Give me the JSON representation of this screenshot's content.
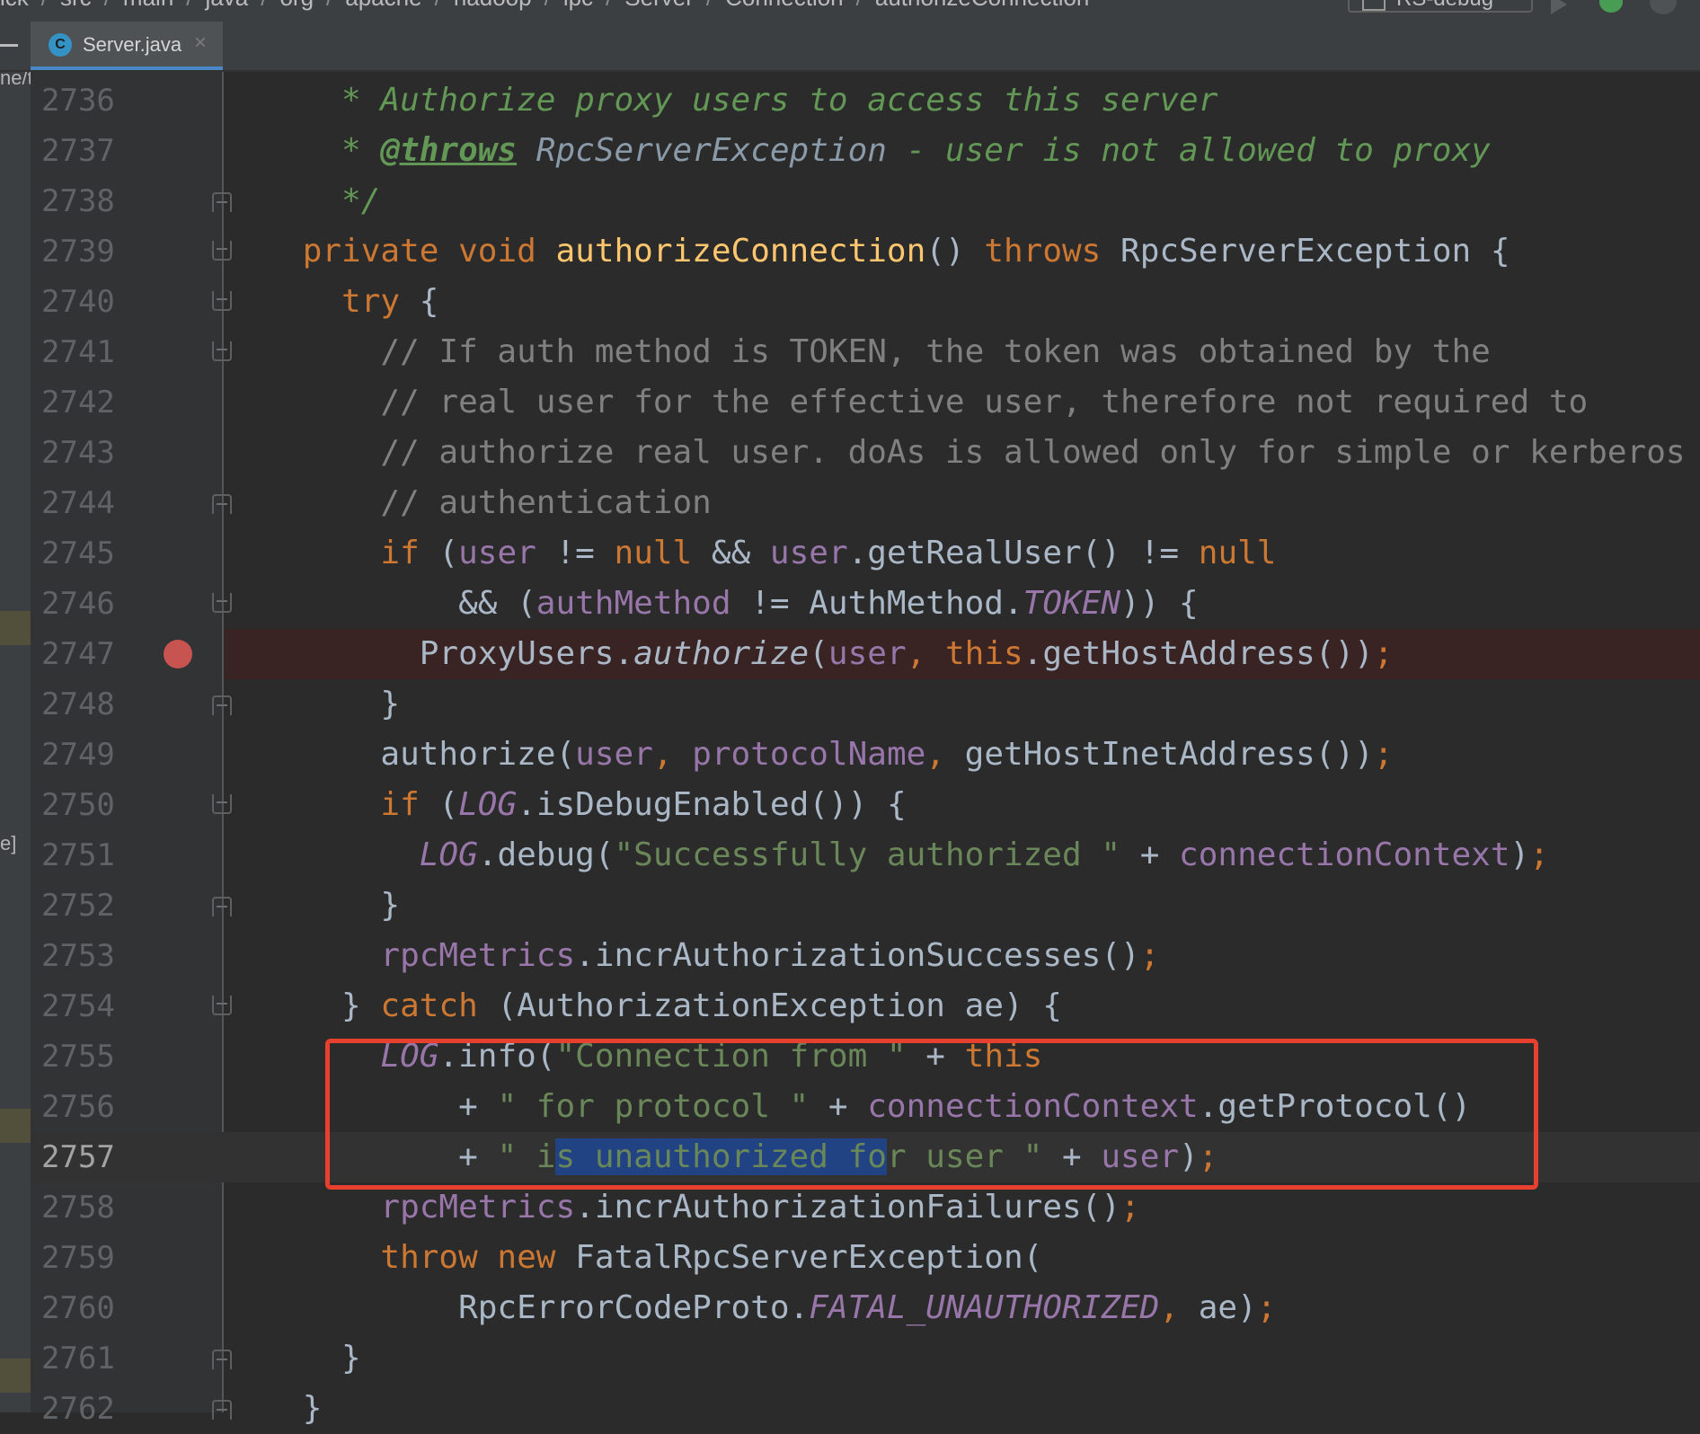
{
  "breadcrumb": [
    "ick",
    "src",
    "main",
    "java",
    "org",
    "apache",
    "hadoop",
    "ipc",
    "Server",
    "Connection",
    "authorizeConnection"
  ],
  "run_config": "RS-debug",
  "tab": {
    "label": "Server.java",
    "icon_letter": "C",
    "close": "×"
  },
  "left_strip": {
    "top_text": "ne/t",
    "mid_text": "e]"
  },
  "lines": [
    {
      "n": "2736",
      "fold": "",
      "segs": [
        [
          "doc",
          "      * Authorize proxy users to access this server"
        ]
      ]
    },
    {
      "n": "2737",
      "fold": "",
      "segs": [
        [
          "doc",
          "      * "
        ],
        [
          "tag",
          "@throws"
        ],
        [
          "doc",
          " "
        ],
        [
          "docref",
          "RpcServerException"
        ],
        [
          "doc",
          " - user is not allowed to proxy"
        ]
      ]
    },
    {
      "n": "2738",
      "fold": "open",
      "segs": [
        [
          "doc",
          "      */"
        ]
      ]
    },
    {
      "n": "2739",
      "fold": "close",
      "segs": [
        [
          "kw",
          "    private void "
        ],
        [
          "fn",
          "authorizeConnection"
        ],
        [
          "",
          "() "
        ],
        [
          "kw",
          "throws "
        ],
        [
          "",
          "RpcServerException {"
        ]
      ]
    },
    {
      "n": "2740",
      "fold": "close",
      "segs": [
        [
          "kw",
          "      try "
        ],
        [
          "",
          "{"
        ]
      ]
    },
    {
      "n": "2741",
      "fold": "close",
      "segs": [
        [
          "cm",
          "        // If auth method is TOKEN, the token was obtained by the"
        ]
      ]
    },
    {
      "n": "2742",
      "fold": "",
      "segs": [
        [
          "cm",
          "        // real user for the effective user, therefore not required to"
        ]
      ]
    },
    {
      "n": "2743",
      "fold": "",
      "segs": [
        [
          "cm",
          "        // authorize real user. doAs is allowed only for simple or kerberos"
        ]
      ]
    },
    {
      "n": "2744",
      "fold": "open",
      "segs": [
        [
          "cm",
          "        // authentication"
        ]
      ]
    },
    {
      "n": "2745",
      "fold": "",
      "segs": [
        [
          "kw",
          "        if "
        ],
        [
          "",
          "("
        ],
        [
          "fld",
          "user"
        ],
        [
          "",
          " != "
        ],
        [
          "kw",
          "null"
        ],
        [
          "",
          " && "
        ],
        [
          "fld",
          "user"
        ],
        [
          "",
          ".getRealUser() != "
        ],
        [
          "kw",
          "null"
        ]
      ]
    },
    {
      "n": "2746",
      "fold": "close",
      "segs": [
        [
          "",
          "            && ("
        ],
        [
          "fld",
          "authMethod"
        ],
        [
          "",
          " != AuthMethod."
        ],
        [
          "st",
          "TOKEN"
        ],
        [
          "",
          ")) {"
        ]
      ]
    },
    {
      "n": "2747",
      "fold": "",
      "bp": true,
      "segs": [
        [
          "",
          "          ProxyUsers."
        ],
        [
          "it",
          "authorize"
        ],
        [
          "",
          "("
        ],
        [
          "fld",
          "user"
        ],
        [
          "kw",
          ", this"
        ],
        [
          "",
          ".getHostAddress())"
        ],
        [
          "kw",
          ";"
        ]
      ]
    },
    {
      "n": "2748",
      "fold": "open",
      "segs": [
        [
          "",
          "        }"
        ]
      ]
    },
    {
      "n": "2749",
      "fold": "",
      "segs": [
        [
          "",
          "        authorize("
        ],
        [
          "fld",
          "user"
        ],
        [
          "kw",
          ", "
        ],
        [
          "fld",
          "protocolName"
        ],
        [
          "kw",
          ", "
        ],
        [
          "",
          "getHostInetAddress())"
        ],
        [
          "kw",
          ";"
        ]
      ]
    },
    {
      "n": "2750",
      "fold": "close",
      "segs": [
        [
          "kw",
          "        if "
        ],
        [
          "",
          "("
        ],
        [
          "st",
          "LOG"
        ],
        [
          "",
          ".isDebugEnabled()) {"
        ]
      ]
    },
    {
      "n": "2751",
      "fold": "",
      "segs": [
        [
          "st",
          "          LOG"
        ],
        [
          "",
          ".debug("
        ],
        [
          "str",
          "\"Successfully authorized \""
        ],
        [
          "",
          " + "
        ],
        [
          "fld",
          "connectionContext"
        ],
        [
          "",
          ")"
        ],
        [
          "kw",
          ";"
        ]
      ]
    },
    {
      "n": "2752",
      "fold": "open",
      "segs": [
        [
          "",
          "        }"
        ]
      ]
    },
    {
      "n": "2753",
      "fold": "",
      "segs": [
        [
          "fld",
          "        rpcMetrics"
        ],
        [
          "",
          ".incrAuthorizationSuccesses()"
        ],
        [
          "kw",
          ";"
        ]
      ]
    },
    {
      "n": "2754",
      "fold": "close",
      "segs": [
        [
          "",
          "      } "
        ],
        [
          "kw",
          "catch "
        ],
        [
          "",
          "(AuthorizationException ae) {"
        ]
      ]
    },
    {
      "n": "2755",
      "fold": "",
      "segs": [
        [
          "st",
          "        LOG"
        ],
        [
          "",
          ".info("
        ],
        [
          "str",
          "\"Connection from \""
        ],
        [
          "",
          " + "
        ],
        [
          "kw",
          "this"
        ]
      ]
    },
    {
      "n": "2756",
      "fold": "",
      "segs": [
        [
          "",
          "            + "
        ],
        [
          "str",
          "\" for protocol \""
        ],
        [
          "",
          " + "
        ],
        [
          "fld",
          "connectionContext"
        ],
        [
          "",
          ".getProtocol()"
        ]
      ]
    },
    {
      "n": "2757",
      "fold": "",
      "current": true,
      "segs": [
        [
          "",
          "            + "
        ],
        [
          "str",
          "\" i"
        ],
        [
          "str sel",
          "s unauthorized fo"
        ],
        [
          "str",
          "r user \""
        ],
        [
          "",
          " + "
        ],
        [
          "fld",
          "user"
        ],
        [
          "",
          ")"
        ],
        [
          "kw",
          ";"
        ]
      ]
    },
    {
      "n": "2758",
      "fold": "",
      "segs": [
        [
          "fld",
          "        rpcMetrics"
        ],
        [
          "",
          ".incrAuthorizationFailures()"
        ],
        [
          "kw",
          ";"
        ]
      ]
    },
    {
      "n": "2759",
      "fold": "",
      "segs": [
        [
          "kw",
          "        throw new "
        ],
        [
          "",
          "FatalRpcServerException("
        ]
      ]
    },
    {
      "n": "2760",
      "fold": "",
      "segs": [
        [
          "",
          "            RpcErrorCodeProto."
        ],
        [
          "st",
          "FATAL_UNAUTHORIZED"
        ],
        [
          "kw",
          ", "
        ],
        [
          "",
          "ae)"
        ],
        [
          "kw",
          ";"
        ]
      ]
    },
    {
      "n": "2761",
      "fold": "open",
      "segs": [
        [
          "",
          "      }"
        ]
      ]
    },
    {
      "n": "2762",
      "fold": "open",
      "segs": [
        [
          "",
          "    }"
        ]
      ]
    }
  ]
}
